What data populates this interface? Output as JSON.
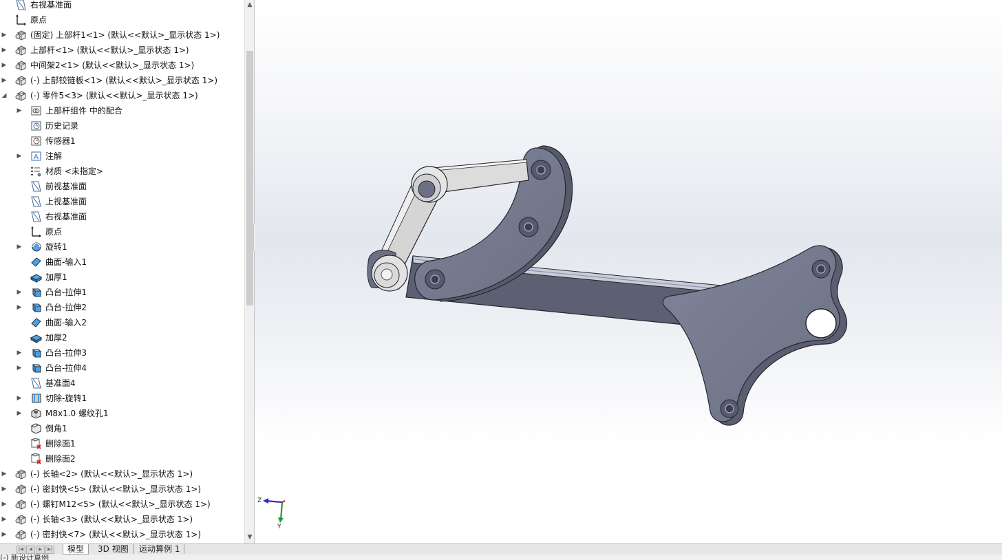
{
  "feature_tree": {
    "items": [
      {
        "label": "右视基准面",
        "icon": "plane-icon",
        "expandable": false,
        "indent": 0
      },
      {
        "label": "原点",
        "icon": "origin-icon",
        "expandable": false,
        "indent": 0
      },
      {
        "label": "(固定) 上部杆1<1> (默认<<默认>_显示状态 1>)",
        "icon": "part-icon",
        "expandable": true,
        "indent": 0
      },
      {
        "label": "上部杆<1> (默认<<默认>_显示状态 1>)",
        "icon": "part-icon",
        "expandable": true,
        "indent": 0
      },
      {
        "label": "中间架2<1> (默认<<默认>_显示状态 1>)",
        "icon": "part-icon",
        "expandable": true,
        "indent": 0
      },
      {
        "label": "(-) 上部铰链板<1> (默认<<默认>_显示状态 1>)",
        "icon": "part-icon",
        "expandable": true,
        "indent": 0
      },
      {
        "label": "(-) 零件5<3> (默认<<默认>_显示状态 1>)",
        "icon": "part-icon",
        "expandable": true,
        "expanded": true,
        "indent": 0
      },
      {
        "label": "上部杆组件 中的配合",
        "icon": "mates-icon",
        "expandable": true,
        "indent": 1
      },
      {
        "label": "历史记录",
        "icon": "history-icon",
        "expandable": false,
        "indent": 1
      },
      {
        "label": "传感器1",
        "icon": "sensor-icon",
        "expandable": false,
        "indent": 1
      },
      {
        "label": "注解",
        "icon": "annotation-icon",
        "expandable": true,
        "indent": 1
      },
      {
        "label": "材质 <未指定>",
        "icon": "material-icon",
        "expandable": false,
        "indent": 1
      },
      {
        "label": "前视基准面",
        "icon": "plane-icon",
        "expandable": false,
        "indent": 1
      },
      {
        "label": "上视基准面",
        "icon": "plane-icon",
        "expandable": false,
        "indent": 1
      },
      {
        "label": "右视基准面",
        "icon": "plane-icon",
        "expandable": false,
        "indent": 1
      },
      {
        "label": "原点",
        "icon": "origin-icon",
        "expandable": false,
        "indent": 1
      },
      {
        "label": "旋转1",
        "icon": "revolve-icon",
        "expandable": true,
        "indent": 1
      },
      {
        "label": "曲面-输入1",
        "icon": "surface-icon",
        "expandable": false,
        "indent": 1
      },
      {
        "label": "加厚1",
        "icon": "thicken-icon",
        "expandable": false,
        "indent": 1
      },
      {
        "label": "凸台-拉伸1",
        "icon": "extrude-icon",
        "expandable": true,
        "indent": 1
      },
      {
        "label": "凸台-拉伸2",
        "icon": "extrude-icon",
        "expandable": true,
        "indent": 1
      },
      {
        "label": "曲面-输入2",
        "icon": "surface-icon",
        "expandable": false,
        "indent": 1
      },
      {
        "label": "加厚2",
        "icon": "thicken-icon",
        "expandable": false,
        "indent": 1
      },
      {
        "label": "凸台-拉伸3",
        "icon": "extrude-icon",
        "expandable": true,
        "indent": 1
      },
      {
        "label": "凸台-拉伸4",
        "icon": "extrude-icon",
        "expandable": true,
        "indent": 1
      },
      {
        "label": "基准面4",
        "icon": "plane-icon",
        "expandable": false,
        "indent": 1
      },
      {
        "label": "切除-旋转1",
        "icon": "cut-revolve-icon",
        "expandable": true,
        "indent": 1
      },
      {
        "label": "M8x1.0 螺纹孔1",
        "icon": "hole-icon",
        "expandable": true,
        "indent": 1
      },
      {
        "label": "倒角1",
        "icon": "chamfer-icon",
        "expandable": false,
        "indent": 1
      },
      {
        "label": "删除面1",
        "icon": "delete-face-icon",
        "expandable": false,
        "indent": 1
      },
      {
        "label": "删除面2",
        "icon": "delete-face-icon",
        "expandable": false,
        "indent": 1
      },
      {
        "label": "(-) 长轴<2> (默认<<默认>_显示状态 1>)",
        "icon": "part-icon",
        "expandable": true,
        "indent": 0
      },
      {
        "label": "(-) 密封快<5> (默认<<默认>_显示状态 1>)",
        "icon": "part-icon",
        "expandable": true,
        "indent": 0
      },
      {
        "label": "(-) 螺钉M12<5> (默认<<默认>_显示状态 1>)",
        "icon": "part-icon",
        "expandable": true,
        "indent": 0
      },
      {
        "label": "(-) 长轴<3> (默认<<默认>_显示状态 1>)",
        "icon": "part-icon",
        "expandable": true,
        "indent": 0
      },
      {
        "label": "(-) 密封快<7> (默认<<默认>_显示状态 1>)",
        "icon": "part-icon",
        "expandable": true,
        "indent": 0
      }
    ]
  },
  "tabs": [
    {
      "label": "模型",
      "active": true
    },
    {
      "label": "3D 视图",
      "active": false
    },
    {
      "label": "运动算例 1",
      "active": false
    }
  ],
  "triad": {
    "x_label": "",
    "y_label": "Y",
    "z_label": "Z"
  },
  "status": {
    "text": "(-) 新设计算例"
  },
  "colors": {
    "part_face": "#767a8c",
    "part_edge": "#2a2d38",
    "link_face": "#d9d9d9",
    "viewport_band": "#e3e7ee"
  }
}
